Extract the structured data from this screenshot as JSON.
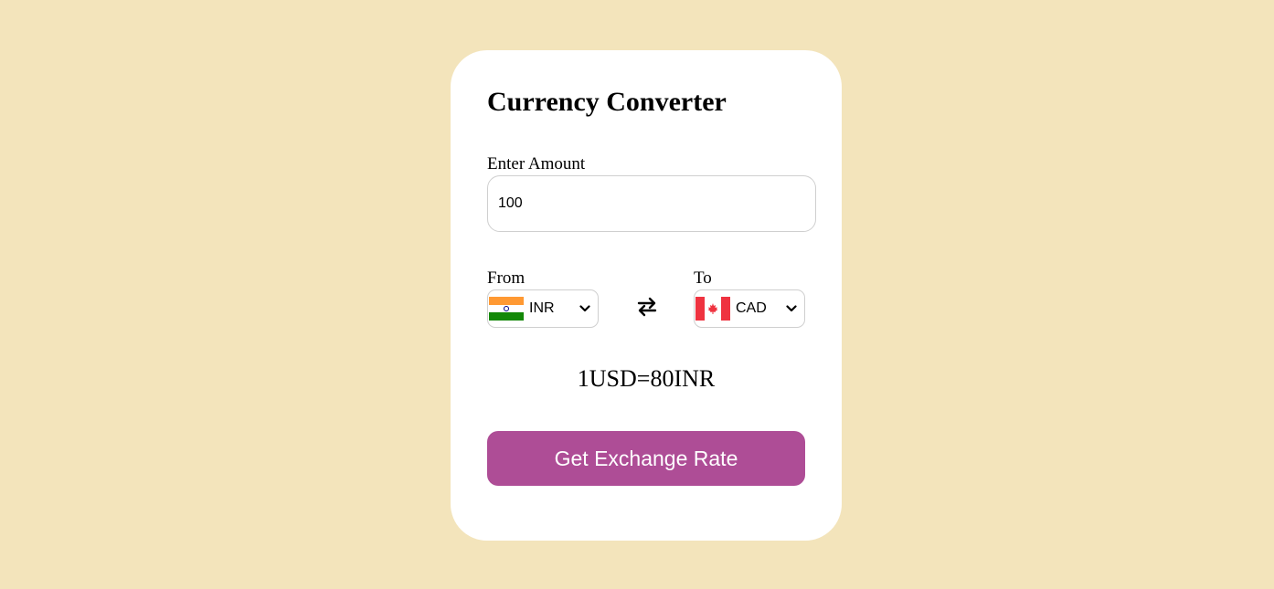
{
  "app": {
    "title": "Currency Converter"
  },
  "amount": {
    "label": "Enter Amount",
    "value": "100"
  },
  "from": {
    "label": "From",
    "currency": "INR",
    "flag_icon": "india-flag-icon"
  },
  "to": {
    "label": "To",
    "currency": "CAD",
    "flag_icon": "canada-flag-icon"
  },
  "swap_icon": "swap-arrows-icon",
  "rate_text": "1USD=80INR",
  "button": {
    "label": "Get Exchange Rate"
  },
  "colors": {
    "background": "#f3e4bb",
    "card": "#ffffff",
    "button": "#ae4d96",
    "button_text": "#ffffff"
  }
}
